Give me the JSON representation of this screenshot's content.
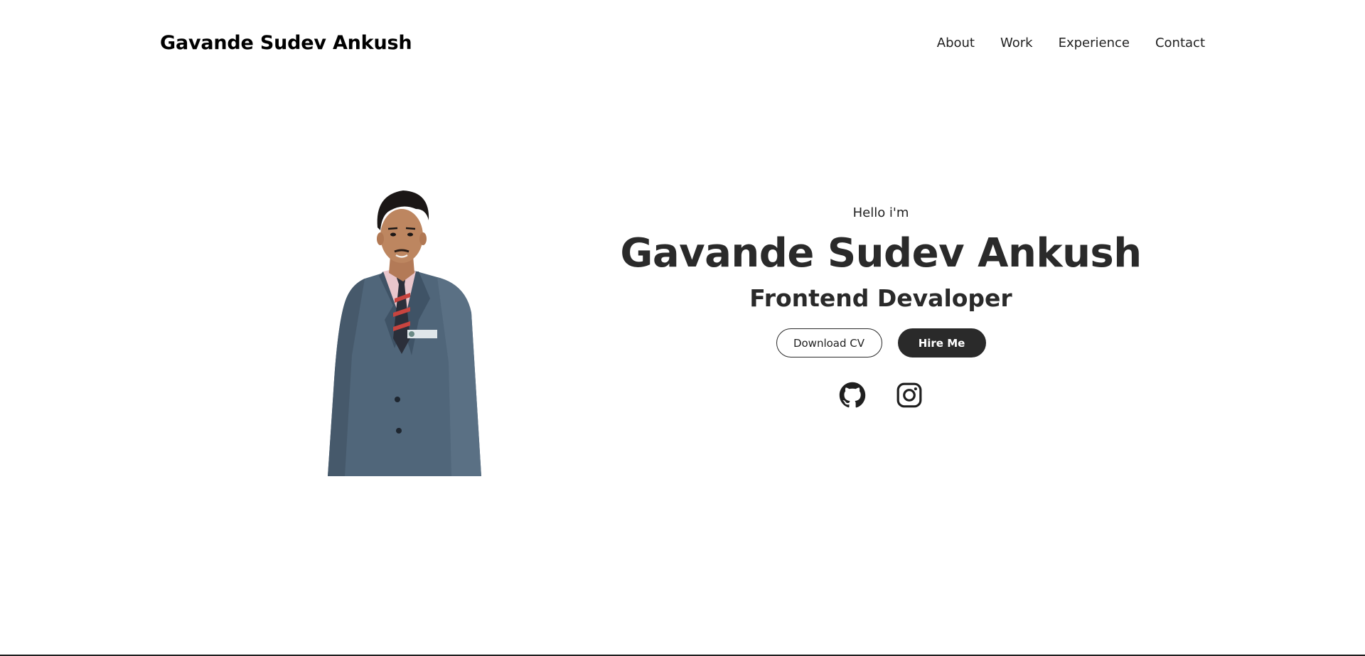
{
  "header": {
    "brand": "Gavande Sudev Ankush",
    "nav": [
      "About",
      "Work",
      "Experience",
      "Contact"
    ]
  },
  "hero": {
    "greeting": "Hello i'm",
    "name": "Gavande Sudev Ankush",
    "role": "Frontend Devaloper",
    "buttons": {
      "download_cv": "Download CV",
      "hire_me": "Hire Me"
    },
    "socials": [
      "github-icon",
      "instagram-icon"
    ]
  },
  "colors": {
    "text": "#1f1f1f",
    "heading": "#2a2a2a",
    "button_dark": "#2a2a2a",
    "suit": "#4f6478",
    "background": "#ffffff"
  }
}
